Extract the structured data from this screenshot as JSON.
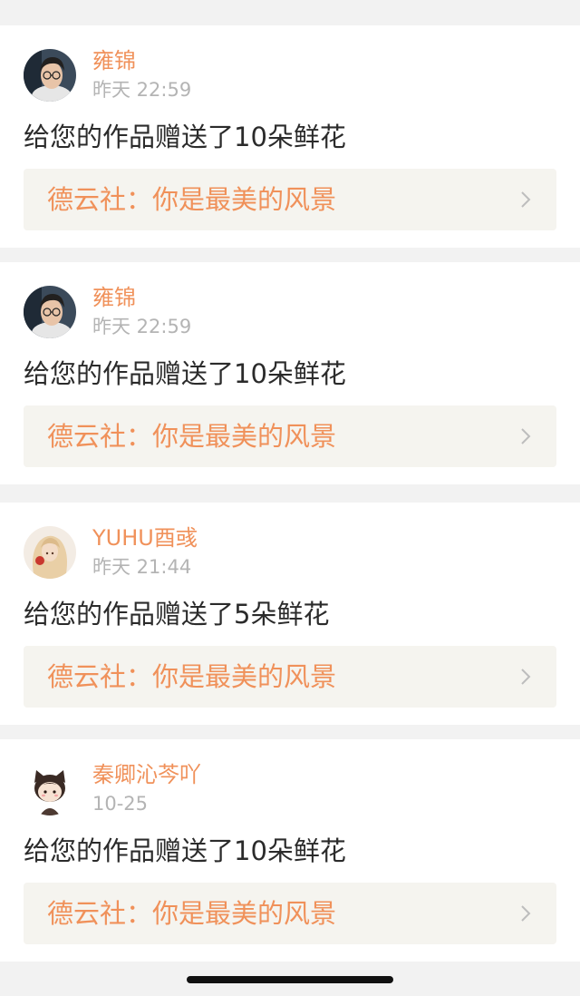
{
  "notifications": [
    {
      "username": "雍锦",
      "time": "昨天 22:59",
      "message": "给您的作品赠送了10朵鲜花",
      "work_title": "德云社：你是最美的风景",
      "avatar_icon": "avatar-glasses-man"
    },
    {
      "username": "雍锦",
      "time": "昨天 22:59",
      "message": "给您的作品赠送了10朵鲜花",
      "work_title": "德云社：你是最美的风景",
      "avatar_icon": "avatar-glasses-man"
    },
    {
      "username": "YUHU酉彧",
      "time": "昨天 21:44",
      "message": "给您的作品赠送了5朵鲜花",
      "work_title": "德云社：你是最美的风景",
      "avatar_icon": "avatar-blonde-girl"
    },
    {
      "username": "秦卿沁芩吖",
      "time": "10-25",
      "message": "给您的作品赠送了10朵鲜花",
      "work_title": "德云社：你是最美的风景",
      "avatar_icon": "avatar-cat-ear-girl"
    }
  ],
  "colors": {
    "accent": "#f0915a",
    "timestamp": "#b4b4b4",
    "text": "#2b2b2b",
    "link_background": "#f5f4ef",
    "page_background": "#f2f2f2"
  }
}
